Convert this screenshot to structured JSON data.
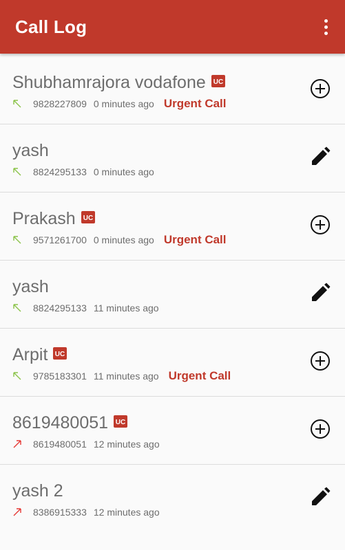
{
  "app_bar": {
    "title": "Call Log",
    "menu_icon": "more-vert-icon",
    "background_color": "#c0392b"
  },
  "calls": [
    {
      "name": "Shubhamrajora vodafone",
      "number": "9828227809",
      "time": "0 minutes ago",
      "direction": "incoming",
      "uc_badge": true,
      "urgent": "Urgent Call",
      "action": "add-circle-icon"
    },
    {
      "name": "yash",
      "number": "8824295133",
      "time": "0 minutes ago",
      "direction": "incoming",
      "uc_badge": false,
      "urgent": "",
      "action": "edit-icon"
    },
    {
      "name": "Prakash",
      "number": "9571261700",
      "time": "0 minutes ago",
      "direction": "incoming",
      "uc_badge": true,
      "urgent": "Urgent Call",
      "action": "add-circle-icon"
    },
    {
      "name": "yash",
      "number": "8824295133",
      "time": "11 minutes ago",
      "direction": "incoming",
      "uc_badge": false,
      "urgent": "",
      "action": "edit-icon"
    },
    {
      "name": "Arpit",
      "number": "9785183301",
      "time": "11 minutes ago",
      "direction": "incoming",
      "uc_badge": true,
      "urgent": "Urgent Call",
      "action": "add-circle-icon"
    },
    {
      "name": "8619480051",
      "number": "8619480051",
      "time": "12 minutes ago",
      "direction": "outgoing",
      "uc_badge": true,
      "urgent": "",
      "action": "add-circle-icon"
    },
    {
      "name": "yash 2",
      "number": "8386915333",
      "time": "12 minutes ago",
      "direction": "outgoing",
      "uc_badge": false,
      "urgent": "",
      "action": "edit-icon"
    }
  ],
  "colors": {
    "accent": "#c0392b",
    "incoming_arrow": "#8bc34a",
    "outgoing_arrow": "#e53935",
    "text_secondary": "#6d6d6d"
  }
}
